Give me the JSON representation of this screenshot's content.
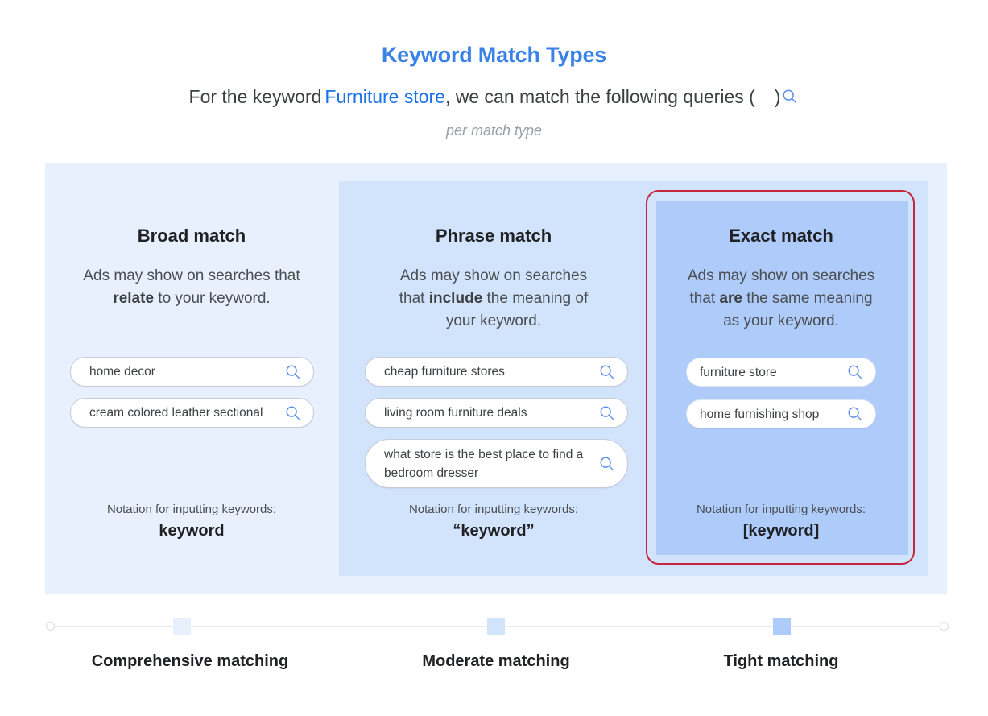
{
  "header": {
    "title": "Keyword Match Types",
    "subtitle_prefix": "For the keyword",
    "keyword": "Furniture store",
    "subtitle_suffix": ", we can match the following queries (",
    "subtitle_close": ")",
    "per_match_type": "per match type"
  },
  "columns": [
    {
      "title": "Broad match",
      "desc_parts": [
        "Ads may show on searches that ",
        "relate",
        " to your keyword."
      ],
      "queries": [
        "home decor",
        "cream colored leather sectional"
      ],
      "notation_label": "Notation for inputting keywords:",
      "notation_value": "keyword"
    },
    {
      "title": "Phrase match",
      "desc_parts": [
        "Ads may show on searches that ",
        "include",
        " the meaning of your keyword."
      ],
      "queries": [
        "cheap furniture stores",
        "living room furniture deals",
        "what store is the best place to find a bedroom dresser"
      ],
      "notation_label": "Notation for inputting keywords:",
      "notation_value": "“keyword”"
    },
    {
      "title": "Exact match",
      "desc_parts": [
        "Ads may show on searches that ",
        "are",
        " the same meaning as your keyword."
      ],
      "queries": [
        "furniture store",
        "home furnishing shop"
      ],
      "notation_label": "Notation for inputting keywords:",
      "notation_value": "[keyword]"
    }
  ],
  "scale": {
    "labels": [
      "Comprehensive matching",
      "Moderate matching",
      "Tight matching"
    ],
    "marker_colors": [
      "#e8f0fe",
      "#d2e3fc",
      "#aecbfa"
    ]
  },
  "colors": {
    "title_blue": "#3b82e6",
    "keyword_blue": "#1a73e8",
    "broad_bg": "#e8f0fe",
    "phrase_bg": "#d2e3fc",
    "exact_bg": "#aecbfa",
    "highlight_red": "#c5283d",
    "search_icon": "#5b8def"
  },
  "icons": {
    "query_icon": "search-icon"
  }
}
